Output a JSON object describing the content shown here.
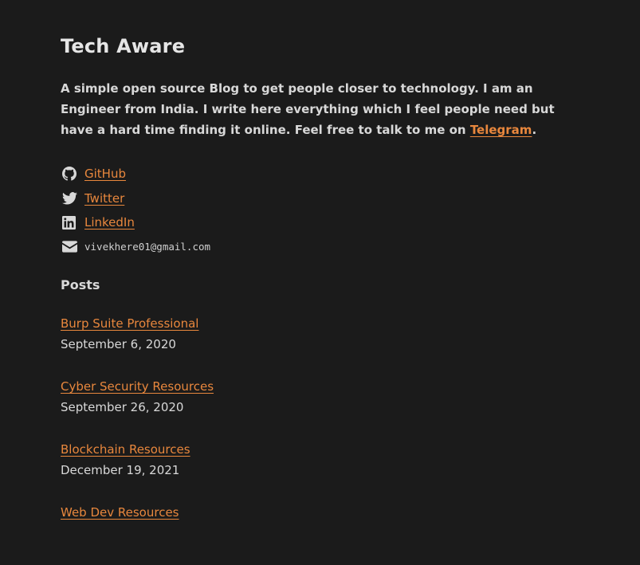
{
  "site": {
    "title": "Tech Aware",
    "bio_text": "A simple open source Blog to get people closer to technology. I am an Engineer from India. I write here everything which I feel people need but have a hard time finding it online. Feel free to talk to me on ",
    "bio_link": "Telegram",
    "bio_end": "."
  },
  "social": [
    {
      "icon": "github-icon",
      "label": "GitHub"
    },
    {
      "icon": "twitter-icon",
      "label": "Twitter"
    },
    {
      "icon": "linkedin-icon",
      "label": "LinkedIn"
    },
    {
      "icon": "envelope-icon",
      "label": "vivekhere01@gmail.com"
    }
  ],
  "posts_heading": "Posts",
  "posts": [
    {
      "title": "Burp Suite Professional",
      "date": "September 6, 2020"
    },
    {
      "title": "Cyber Security Resources",
      "date": "September 26, 2020"
    },
    {
      "title": "Blockchain Resources",
      "date": "December 19, 2021"
    },
    {
      "title": "Web Dev Resources",
      "date": ""
    }
  ],
  "colors": {
    "background": "#1b1b1b",
    "text": "#d8d8d8",
    "link": "#e8873d"
  }
}
